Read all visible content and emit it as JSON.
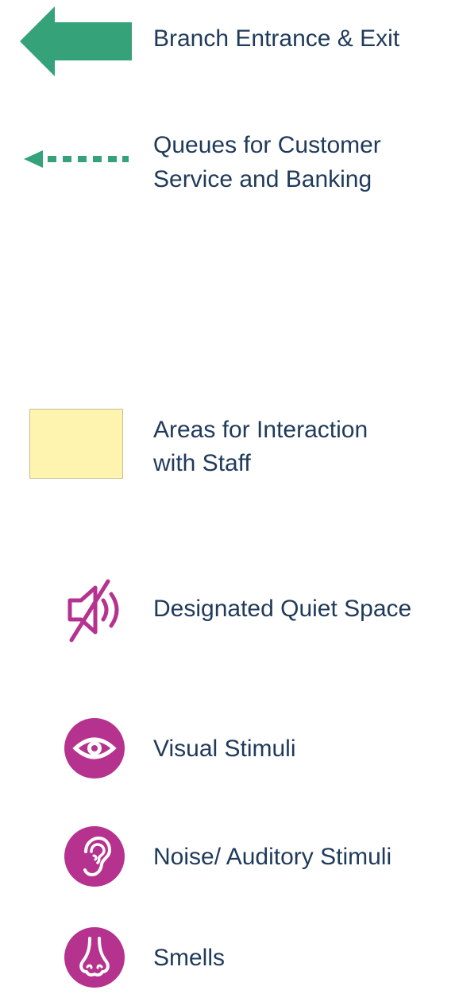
{
  "colors": {
    "teal": "#35a27a",
    "yellow": "#fff3b0",
    "magenta": "#b5338f",
    "text": "#1f3a5a"
  },
  "legend": [
    {
      "icon": "solid-arrow-left-icon",
      "label": "Branch Entrance & Exit"
    },
    {
      "icon": "dotted-arrow-left-icon",
      "label_lines": [
        "Queues for Customer",
        "Service and Banking"
      ]
    },
    {
      "icon": "yellow-area-swatch",
      "label_lines": [
        "Areas for Interaction",
        "with Staff"
      ]
    },
    {
      "icon": "muted-speaker-icon",
      "label": "Designated Quiet Space"
    },
    {
      "icon": "eye-icon",
      "label": "Visual Stimuli"
    },
    {
      "icon": "ear-icon",
      "label": "Noise/ Auditory Stimuli"
    },
    {
      "icon": "nose-icon",
      "label": "Smells"
    }
  ]
}
